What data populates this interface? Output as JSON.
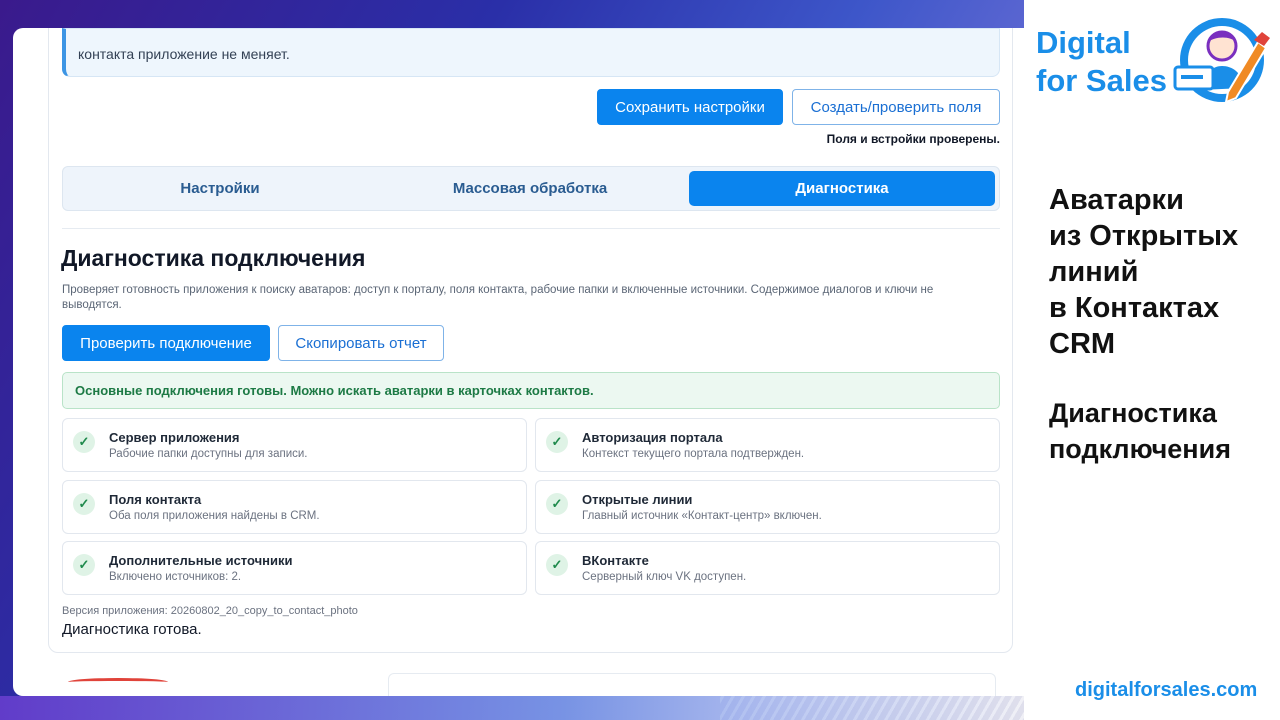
{
  "info_box": {
    "text": "контакта приложение не меняет."
  },
  "actions": {
    "save_label": "Сохранить настройки",
    "create_check_label": "Создать/проверить поля",
    "status_note": "Поля и встройки проверены."
  },
  "tabs": [
    {
      "label": "Настройки",
      "active": false
    },
    {
      "label": "Массовая обработка",
      "active": false
    },
    {
      "label": "Диагностика",
      "active": true
    }
  ],
  "diagnostics": {
    "title": "Диагностика подключения",
    "description": "Проверяет готовность приложения к поиску аватаров: доступ к порталу, поля контакта, рабочие папки и включенные источники. Содержимое диалогов и ключи не выводятся.",
    "check_button": "Проверить подключение",
    "copy_button": "Скопировать отчет",
    "status_message": "Основные подключения готовы. Можно искать аватарки в карточках контактов.",
    "checks": [
      {
        "title": "Сервер приложения",
        "subtitle": "Рабочие папки доступны для записи.",
        "icon": "check-icon"
      },
      {
        "title": "Авторизация портала",
        "subtitle": "Контекст текущего портала подтвержден.",
        "icon": "check-icon"
      },
      {
        "title": "Поля контакта",
        "subtitle": "Оба поля приложения найдены в CRM.",
        "icon": "check-icon"
      },
      {
        "title": "Открытые линии",
        "subtitle": "Главный источник «Контакт-центр» включен.",
        "icon": "check-icon"
      },
      {
        "title": "Дополнительные источники",
        "subtitle": "Включено источников: 2.",
        "icon": "check-icon"
      },
      {
        "title": "ВКонтакте",
        "subtitle": "Серверный ключ VK доступен.",
        "icon": "check-icon"
      }
    ],
    "version": "Версия приложения: 20260802_20_copy_to_contact_photo",
    "ready_text": "Диагностика готова."
  },
  "branding": {
    "brand_line1": "Digital",
    "brand_line2": "for Sales",
    "heading_lines": [
      "Аватарки",
      "из Открытых",
      "линий",
      "в Контактах",
      "CRM"
    ],
    "sub_lines": [
      "Диагностика",
      "подключения"
    ],
    "website": "digitalforsales.com",
    "accent_color": "#1a8ee8",
    "primary_color": "#0a84ee",
    "success_color": "#1d7a45"
  }
}
